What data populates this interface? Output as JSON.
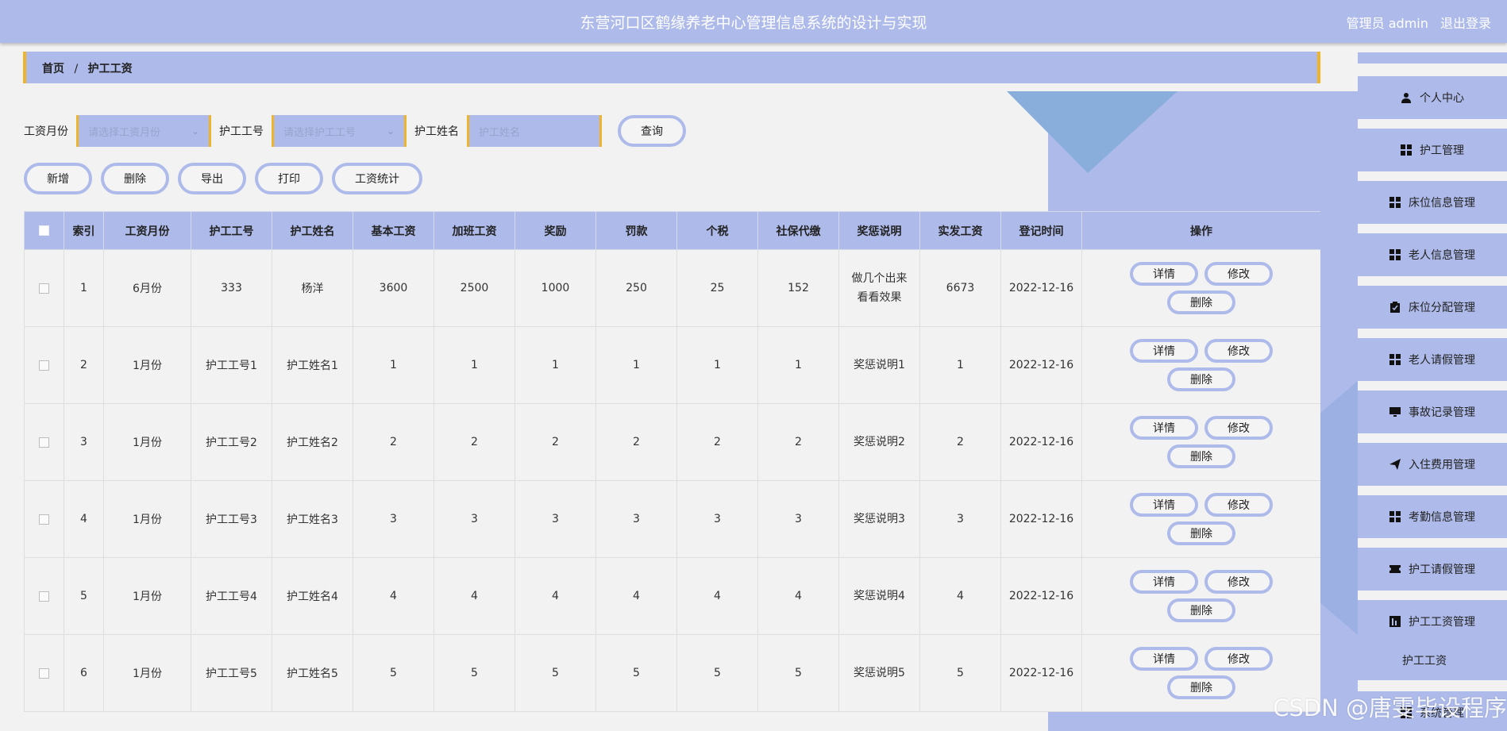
{
  "header": {
    "title": "东营河口区鹤缘养老中心管理信息系统的设计与实现",
    "user_label": "管理员 admin",
    "logout_label": "退出登录"
  },
  "breadcrumb": {
    "home": "首页",
    "separator": "/",
    "current": "护工工资"
  },
  "search": {
    "month_label": "工资月份",
    "month_placeholder": "请选择工资月份",
    "nurse_id_label": "护工工号",
    "nurse_id_placeholder": "请选择护工工号",
    "nurse_name_label": "护工姓名",
    "nurse_name_placeholder": "护工姓名",
    "query_label": "查询"
  },
  "actions": {
    "add": "新增",
    "delete": "删除",
    "export": "导出",
    "print": "打印",
    "stats": "工资统计"
  },
  "table": {
    "headers": [
      "索引",
      "工资月份",
      "护工工号",
      "护工姓名",
      "基本工资",
      "加班工资",
      "奖励",
      "罚款",
      "个税",
      "社保代缴",
      "奖惩说明",
      "实发工资",
      "登记时间",
      "操作"
    ],
    "op_labels": {
      "detail": "详情",
      "edit": "修改",
      "delete": "删除"
    },
    "rows": [
      [
        "1",
        "6月份",
        "333",
        "杨洋",
        "3600",
        "2500",
        "1000",
        "250",
        "25",
        "152",
        "做几个出来看看效果",
        "6673",
        "2022-12-16"
      ],
      [
        "2",
        "1月份",
        "护工工号1",
        "护工姓名1",
        "1",
        "1",
        "1",
        "1",
        "1",
        "1",
        "奖惩说明1",
        "1",
        "2022-12-16"
      ],
      [
        "3",
        "1月份",
        "护工工号2",
        "护工姓名2",
        "2",
        "2",
        "2",
        "2",
        "2",
        "2",
        "奖惩说明2",
        "2",
        "2022-12-16"
      ],
      [
        "4",
        "1月份",
        "护工工号3",
        "护工姓名3",
        "3",
        "3",
        "3",
        "3",
        "3",
        "3",
        "奖惩说明3",
        "3",
        "2022-12-16"
      ],
      [
        "5",
        "1月份",
        "护工工号4",
        "护工姓名4",
        "4",
        "4",
        "4",
        "4",
        "4",
        "4",
        "奖惩说明4",
        "4",
        "2022-12-16"
      ],
      [
        "6",
        "1月份",
        "护工工号5",
        "护工姓名5",
        "5",
        "5",
        "5",
        "5",
        "5",
        "5",
        "奖惩说明5",
        "5",
        "2022-12-16"
      ]
    ]
  },
  "sidebar": {
    "items": [
      {
        "label": "个人中心",
        "icon": "user-icon"
      },
      {
        "label": "护工管理",
        "icon": "grid-icon"
      },
      {
        "label": "床位信息管理",
        "icon": "grid-icon"
      },
      {
        "label": "老人信息管理",
        "icon": "grid-icon"
      },
      {
        "label": "床位分配管理",
        "icon": "clipboard-icon"
      },
      {
        "label": "老人请假管理",
        "icon": "grid-icon"
      },
      {
        "label": "事故记录管理",
        "icon": "monitor-icon"
      },
      {
        "label": "入住费用管理",
        "icon": "send-icon"
      },
      {
        "label": "考勤信息管理",
        "icon": "grid-icon"
      },
      {
        "label": "护工请假管理",
        "icon": "ticket-icon"
      },
      {
        "label": "护工工资管理",
        "icon": "chart-icon"
      }
    ],
    "sub_active": "护工工资",
    "partial_item": "系统管理"
  },
  "watermark": "CSDN @唐雯毕设程序",
  "colors": {
    "header_bg": "#aebbea",
    "accent": "#f0b429",
    "page_bg": "#f2f2f2"
  }
}
